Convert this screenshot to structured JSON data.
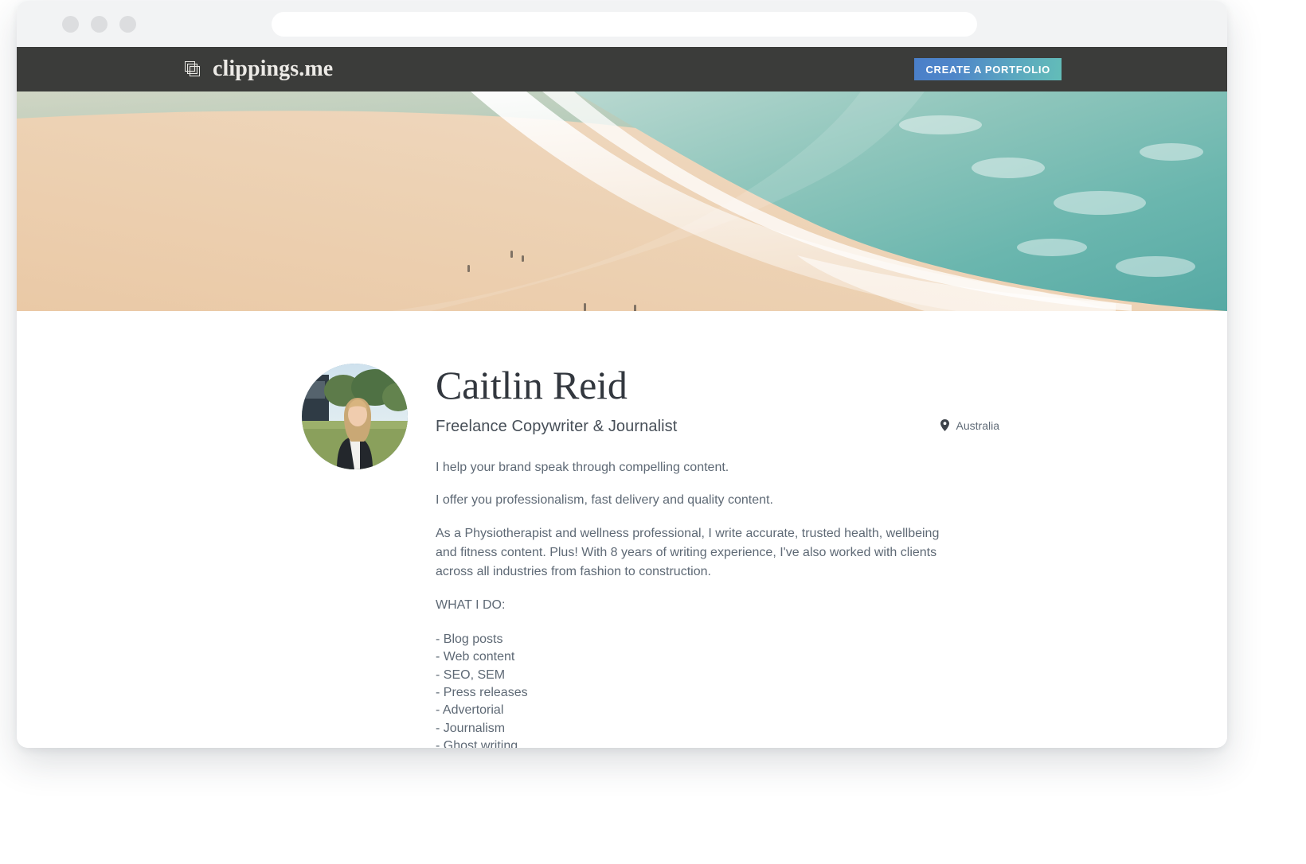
{
  "browser": {
    "url_value": "",
    "url_placeholder": "",
    "traffic_lights": [
      "close",
      "minimize",
      "maximize"
    ]
  },
  "nav": {
    "brand_name": "clippings.me",
    "brand_icon": "layered-squares-icon",
    "cta_label": "CREATE A PORTFOLIO",
    "background_color": "#3b3c3a",
    "cta_gradient_from": "#4a7fc9",
    "cta_gradient_to": "#63bdb8"
  },
  "hero": {
    "image_alt": "aerial beach shoreline with turquoise surf and pale sand"
  },
  "profile": {
    "avatar_alt": "portrait of Caitlin Reid standing outdoors",
    "name": "Caitlin Reid",
    "title": "Freelance Copywriter & Journalist",
    "location_icon": "map-pin-icon",
    "location": "Australia",
    "bio": [
      "I help your brand speak through compelling content.",
      "I offer you professionalism, fast delivery and quality content.",
      "As a Physiotherapist and wellness professional, I write accurate, trusted health, wellbeing and fitness content. Plus! With 8 years of writing experience, I've also worked with clients across all industries from fashion to construction.",
      "WHAT I DO:"
    ],
    "services": [
      "- Blog posts",
      "- Web content",
      "- SEO, SEM",
      "- Press releases",
      "- Advertorial",
      "- Journalism",
      "- Ghost writing"
    ]
  }
}
